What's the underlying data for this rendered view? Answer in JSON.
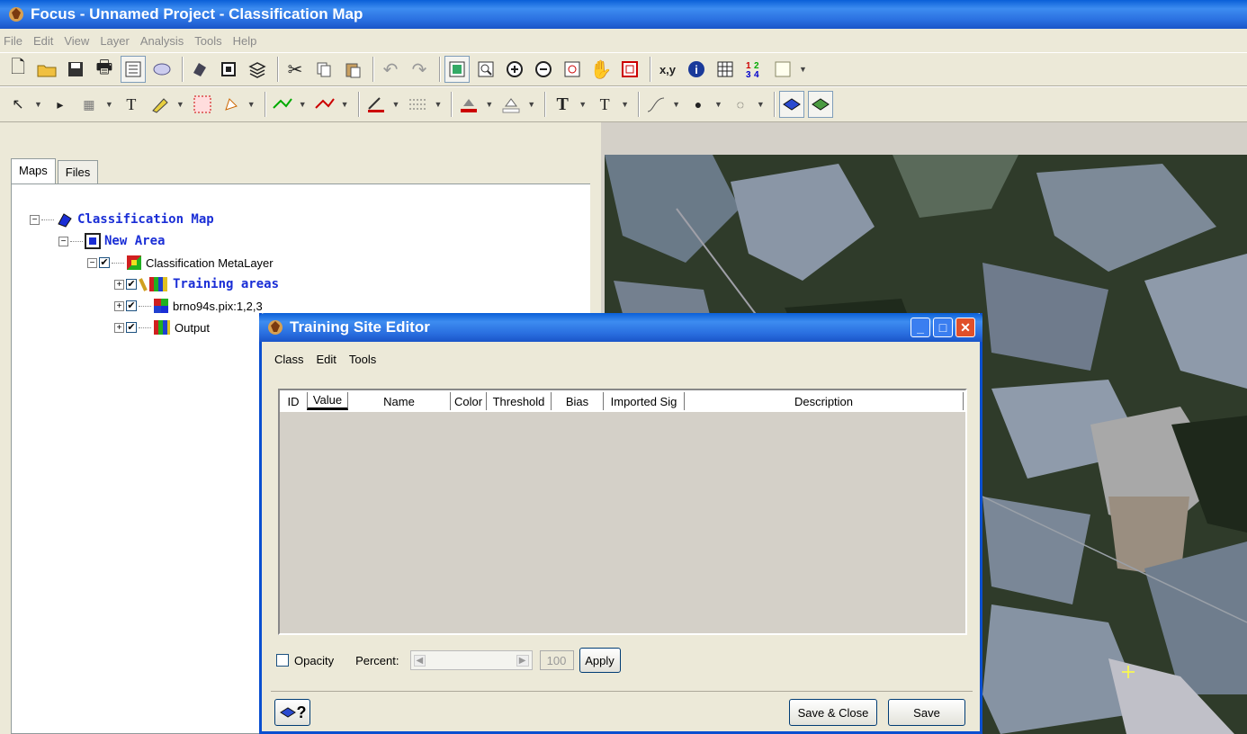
{
  "window": {
    "title": "Focus - Unnamed Project - Classification Map"
  },
  "menubar": [
    "File",
    "Edit",
    "View",
    "Layer",
    "Analysis",
    "Tools",
    "Help"
  ],
  "toolbar1": {
    "coords_label": "x,y",
    "stats_label": "12\n34"
  },
  "tabs": [
    {
      "label": "Maps",
      "active": true
    },
    {
      "label": "Files",
      "active": false
    }
  ],
  "tree": {
    "root": "Classification Map",
    "area": "New Area",
    "metalayer": "Classification MetaLayer",
    "layers": [
      {
        "label": "Training areas",
        "style": "bold-blue"
      },
      {
        "label": "brno94s.pix:1,2,3",
        "style": "plain"
      },
      {
        "label": "Output",
        "style": "plain"
      }
    ]
  },
  "dialog": {
    "title": "Training Site Editor",
    "menu": [
      "Class",
      "Edit",
      "Tools"
    ],
    "columns": [
      "ID",
      "Value",
      "Name",
      "Color",
      "Threshold",
      "Bias",
      "Imported Sig",
      "Description"
    ],
    "opacity_label": "Opacity",
    "percent_label": "Percent:",
    "percent_value": "100",
    "apply_label": "Apply",
    "save_close_label": "Save & Close",
    "save_label": "Save",
    "help_label": "?"
  },
  "colors": {
    "titlebar": "#2a6fe0",
    "tree_blue": "#1a2ed6",
    "close_button": "#e0502a"
  }
}
